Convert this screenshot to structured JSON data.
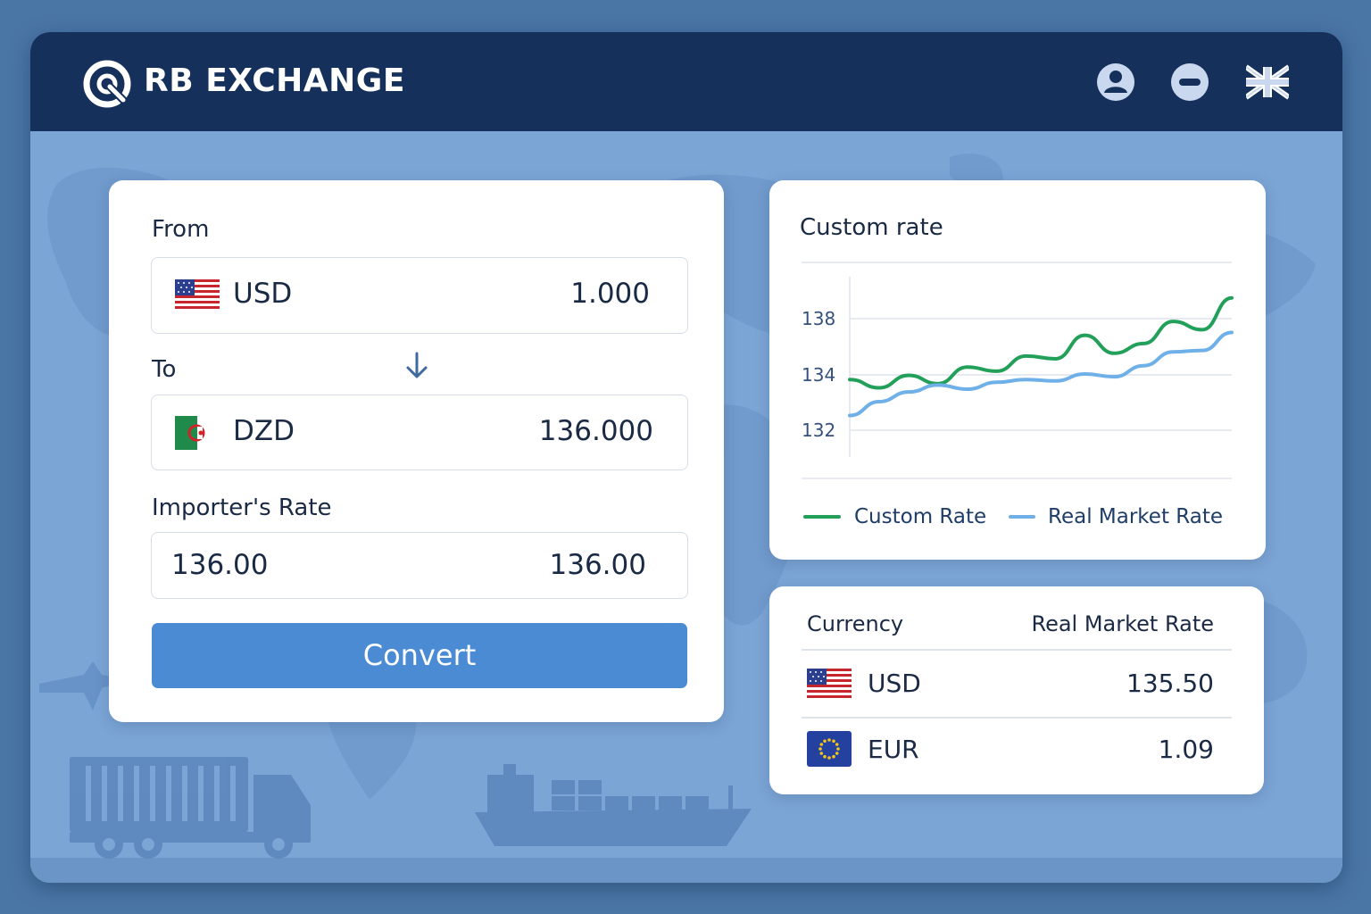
{
  "app": {
    "brand": "RB EXCHANGE"
  },
  "header_icons": [
    "user-account-icon",
    "minus-circle-icon",
    "uk-flag-icon"
  ],
  "converter": {
    "from_label": "From",
    "from_currency": "USD",
    "from_amount": "1.000",
    "to_label": "To",
    "to_currency": "DZD",
    "to_amount": "136.000",
    "rate_label": "Importer's Rate",
    "rate_input": "136.00",
    "rate_value": "136.00",
    "convert_button": "Convert"
  },
  "chart_card": {
    "title": "Custom rate",
    "legend_custom": "Custom Rate",
    "legend_market": "Real Market Rate",
    "tick_138": "138",
    "tick_134": "134",
    "tick_132": "132"
  },
  "chart_data": {
    "type": "line",
    "title": "Custom rate",
    "y_ticks": [
      138,
      134,
      132
    ],
    "grid": true,
    "legend_position": "bottom",
    "series": [
      {
        "name": "Custom Rate",
        "color": "#22a05a",
        "values": [
          133.6,
          133.0,
          133.9,
          133.3,
          134.5,
          134.2,
          135.3,
          135.1,
          136.8,
          135.5,
          136.2,
          137.8,
          137.2,
          139.5
        ]
      },
      {
        "name": "Real Market Rate",
        "color": "#6fb0e8",
        "values": [
          131.0,
          132.0,
          132.7,
          133.2,
          132.9,
          133.4,
          133.6,
          133.5,
          134.0,
          133.8,
          134.6,
          135.6,
          135.7,
          137.0
        ]
      }
    ]
  },
  "rates_table": {
    "header_currency": "Currency",
    "header_rate": "Real Market Rate",
    "rows": [
      {
        "currency": "USD",
        "rate": "135.50"
      },
      {
        "currency": "EUR",
        "rate": "1.09"
      }
    ]
  },
  "colors": {
    "header_bg": "#15305b",
    "accent_button": "#4a8bd4",
    "custom_rate_line": "#22a05a",
    "market_rate_line": "#6fb0e8"
  }
}
